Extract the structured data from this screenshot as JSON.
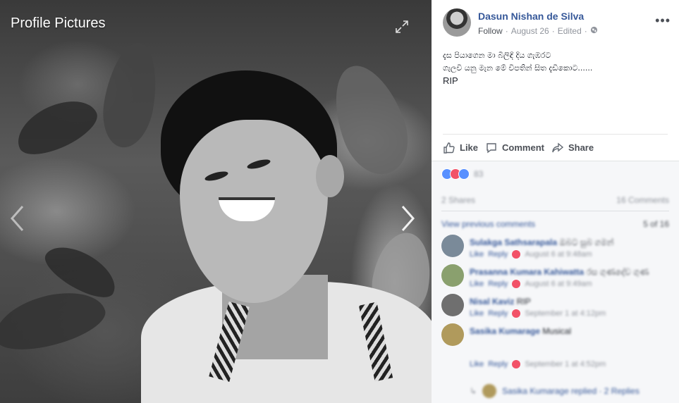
{
  "photo": {
    "album_title": "Profile Pictures",
    "expand_icon": "expand-icon",
    "prev_icon": "chevron-left-icon",
    "next_icon": "chevron-right-icon"
  },
  "post": {
    "author": "Dasun Nishan de Silva",
    "follow": "Follow",
    "separator": "·",
    "date": "August 26",
    "edited": "Edited",
    "privacy_icon": "globe-icon",
    "more_icon": "more-dots-icon",
    "text_line1": "දැස පියාගෙන මා බිලිඳි දිය ගැඹරට",
    "text_line2": "ගැලවී යනු මැන මේ විපතින් සිත දැඩිකොට......",
    "text_line3": "RIP"
  },
  "actions": {
    "like": "Like",
    "comment": "Comment",
    "share": "Share"
  },
  "reactions": {
    "count": "83",
    "colors": [
      "#5890ff",
      "#f25268",
      "#5890ff"
    ]
  },
  "stats": {
    "shares": "2 Shares",
    "comments": "16 Comments"
  },
  "view_previous": {
    "label": "View previous comments",
    "count": "5 of 16"
  },
  "comments": [
    {
      "name": "Sulakga Sathsarapala",
      "text": "ඔබට සුබ ගමන්",
      "like": "Like",
      "reply": "Reply",
      "time": "August 6 at 9:48am",
      "avatar_color": "#7a8a99"
    },
    {
      "name": "Prasanna Kumara Kahiwatta",
      "text": "රස ගුණදේව ගුණ",
      "like": "Like",
      "reply": "Reply",
      "time": "August 6 at 9:49am",
      "avatar_color": "#8aa06e"
    },
    {
      "name": "Nisal Kaviz",
      "text": "RIP",
      "like": "Like",
      "reply": "Reply",
      "time": "September 1 at 4:12pm",
      "avatar_color": "#6f6f6f"
    },
    {
      "name": "Sasika Kumarage",
      "text": "Musical",
      "like": "Like",
      "reply": "Reply",
      "time": "September 1 at 4:52pm",
      "avatar_color": "#b09a5c"
    }
  ],
  "reply_row": {
    "text": "Sasika Kumarage replied · 2 Replies"
  }
}
